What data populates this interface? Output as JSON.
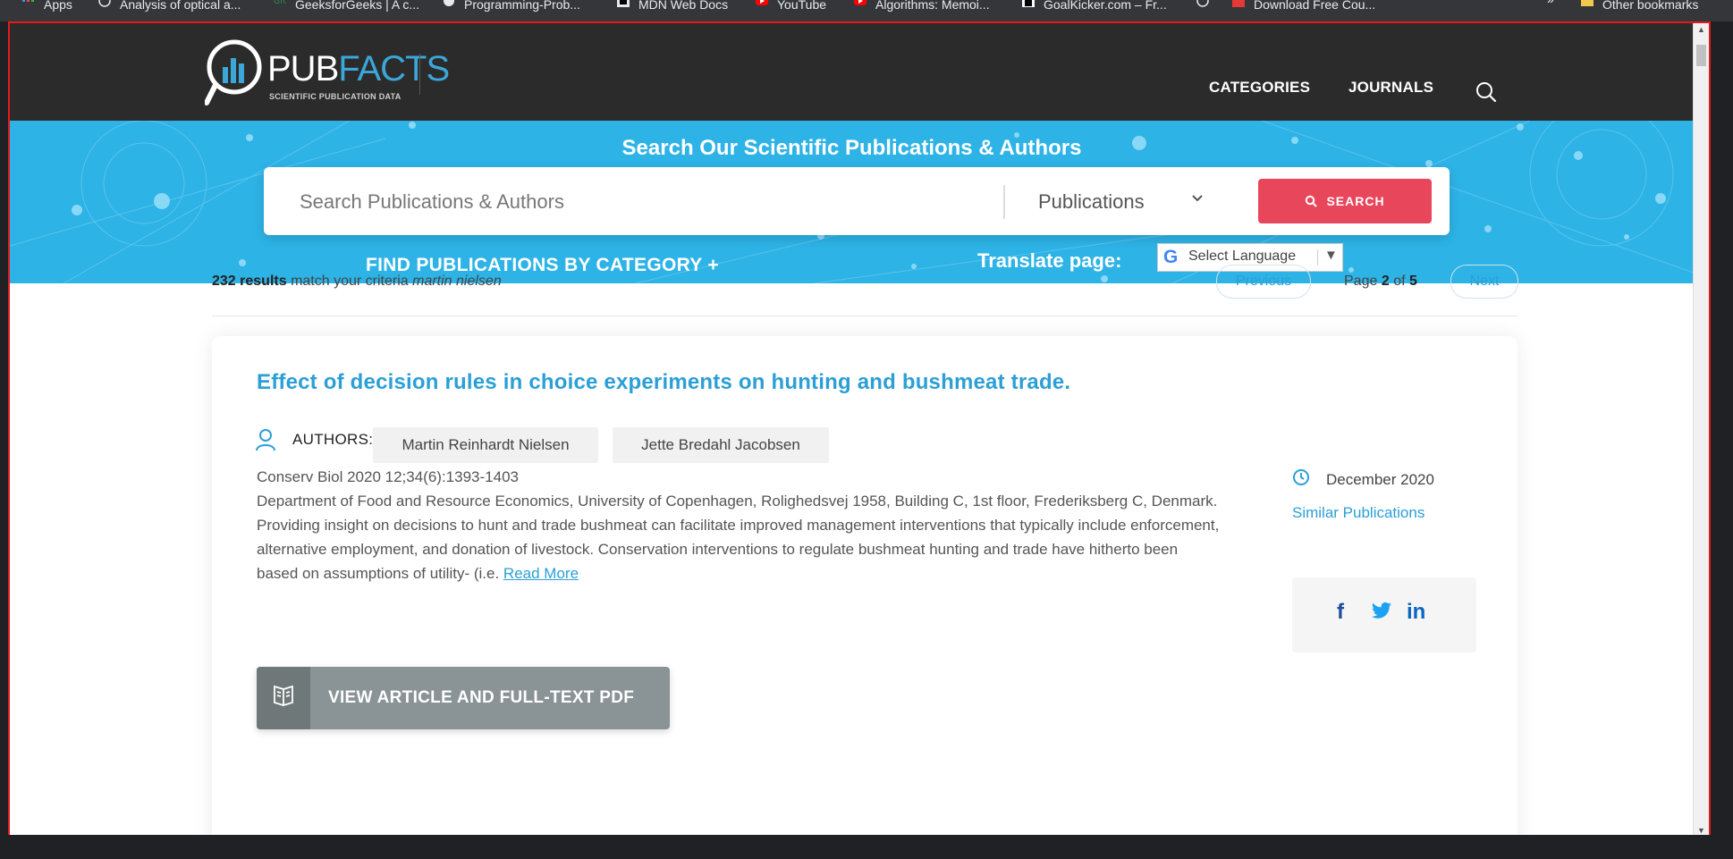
{
  "bookmarks": {
    "items": [
      {
        "label": "Apps",
        "icon": "apps-grid-icon"
      },
      {
        "label": "Analysis of optical a...",
        "icon": "globe-icon"
      },
      {
        "label": "GeeksforGeeks | A c...",
        "icon": "geeksforgeeks-icon"
      },
      {
        "label": "Programming-Prob...",
        "icon": "github-icon"
      },
      {
        "label": "MDN Web Docs",
        "icon": "mdn-icon"
      },
      {
        "label": "YouTube",
        "icon": "youtube-icon"
      },
      {
        "label": "Algorithms: Memoi...",
        "icon": "youtube-icon"
      },
      {
        "label": "GoalKicker.com – Fr...",
        "icon": "goalkicker-icon"
      },
      {
        "label": "",
        "icon": "globe-icon"
      },
      {
        "label": "Download Free Cou...",
        "icon": "fco-icon"
      }
    ],
    "overflow": "»",
    "other": "Other bookmarks"
  },
  "header": {
    "logo_main_a": "PUB",
    "logo_main_b": "FACTS",
    "logo_sub": "SCIENTIFIC PUBLICATION DATA",
    "nav": [
      "CATEGORIES",
      "JOURNALS"
    ]
  },
  "hero": {
    "title": "Search Our Scientific Publications & Authors",
    "search_placeholder": "Search Publications & Authors",
    "select_value": "Publications",
    "search_button": "SEARCH",
    "find_category": "FIND PUBLICATIONS BY CATEGORY +",
    "translate_label": "Translate page:",
    "translate_select": "Select Language"
  },
  "results": {
    "count": "232 results",
    "match_text": "match your criteria",
    "query": "martin nielsen",
    "prev": "Previous",
    "next": "Next",
    "page_label": "Page",
    "page_current": "2",
    "page_of": "of",
    "page_total": "5"
  },
  "article": {
    "title": "Effect of decision rules in choice experiments on hunting and bushmeat trade.",
    "authors_label": "AUTHORS:",
    "authors": [
      "Martin Reinhardt Nielsen",
      "Jette Bredahl Jacobsen"
    ],
    "citation": "Conserv Biol 2020 12;34(6):1393-1403",
    "affiliation": "Department of Food and Resource Economics, University of Copenhagen, Rolighedsvej 1958, Building C, 1st floor, Frederiksberg C, Denmark.",
    "abstract": "Providing insight on decisions to hunt and trade bushmeat can facilitate improved management interventions that typically include enforcement, alternative employment, and donation of livestock. Conservation interventions to regulate bushmeat hunting and trade have hitherto been based on assumptions of utility- (i.e.",
    "read_more": "Read More",
    "date": "December 2020",
    "similar": "Similar Publications",
    "share": [
      "f",
      "t",
      "in"
    ],
    "view_button": "VIEW ARTICLE AND FULL-TEXT PDF"
  },
  "colors": {
    "accent": "#2b9fd6",
    "hero_bg": "#2db3e6",
    "search_button": "#e8465b",
    "header_bg": "#2b2b2b"
  }
}
